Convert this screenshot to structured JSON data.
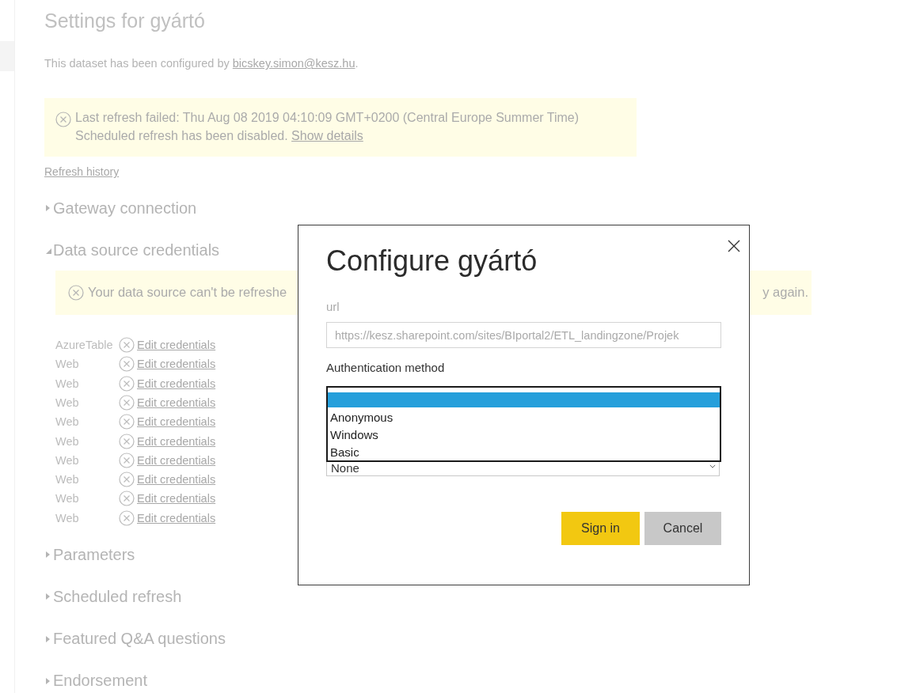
{
  "page": {
    "title": "Settings for gyártó",
    "configured_by": "This dataset has been configured by",
    "configured_by_link": "bicskey.simon@kesz.hu",
    "configured_by_end": ".",
    "refresh_alert": {
      "line_1": "Last refresh failed: Thu Aug 08 2019 04:10:09 GMT+0200 (Central Europe Summer Time)",
      "line_2": "Scheduled refresh has been disabled.",
      "link": "Show details"
    },
    "refresh_history": "Refresh history",
    "sections": [
      {
        "label": "Gateway connection",
        "expanded": false
      },
      {
        "label": "Data source credentials",
        "expanded": true,
        "alert_start": "Your data source can't be refreshe",
        "alert_end": "y again.",
        "sources": [
          {
            "type": "AzureTable",
            "link": "Edit credentials"
          },
          {
            "type": "Web",
            "link": "Edit credentials"
          },
          {
            "type": "Web",
            "link": "Edit credentials"
          },
          {
            "type": "Web",
            "link": "Edit credentials"
          },
          {
            "type": "Web",
            "link": "Edit credentials"
          },
          {
            "type": "Web",
            "link": "Edit credentials"
          },
          {
            "type": "Web",
            "link": "Edit credentials"
          },
          {
            "type": "Web",
            "link": "Edit credentials"
          },
          {
            "type": "Web",
            "link": "Edit credentials"
          },
          {
            "type": "Web",
            "link": "Edit credentials"
          }
        ]
      },
      {
        "label": "Parameters",
        "expanded": false
      },
      {
        "label": "Scheduled refresh",
        "expanded": false
      },
      {
        "label": "Featured Q&A questions",
        "expanded": false
      },
      {
        "label": "Endorsement",
        "expanded": false
      }
    ]
  },
  "dialog": {
    "title": "Configure gyártó",
    "url_label": "url",
    "url_value": "https://kesz.sharepoint.com/sites/BIportal2/ETL_landingzone/Projek",
    "auth_label": "Authentication method",
    "auth_value": "None",
    "auth_options": [
      {
        "selected": true
      },
      {
        "label": "Anonymous",
        "selected": false
      },
      {
        "label": "Windows",
        "selected": false
      },
      {
        "label": "Basic",
        "selected": false
      }
    ],
    "buttons": [
      {
        "label": "Sign in",
        "kind": "primary"
      },
      {
        "label": "Cancel",
        "kind": "secondary"
      }
    ]
  }
}
